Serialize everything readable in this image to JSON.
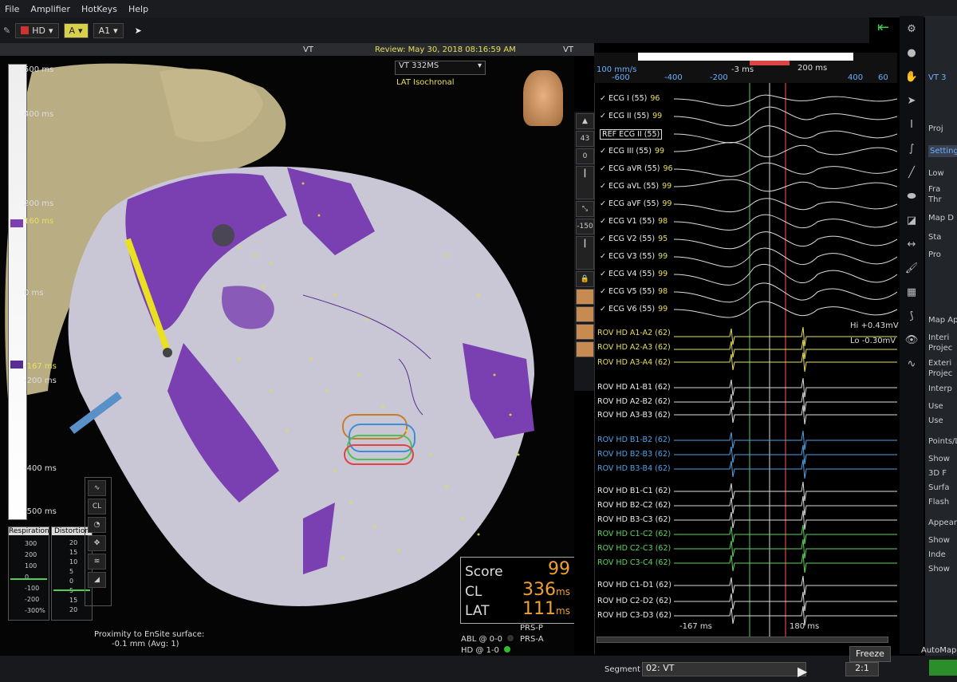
{
  "menu": [
    "File",
    "Amplifier",
    "HotKeys",
    "Help"
  ],
  "toolbar": {
    "catheter": "HD",
    "channel_a": "A",
    "channel_a1": "A1"
  },
  "titlebar": {
    "view_label": "VT",
    "review": "Review: May 30, 2018 08:16:59 AM",
    "view_label_right": "VT"
  },
  "map": {
    "name": "VT 332MS",
    "subtitle": "LAT Isochronal"
  },
  "scale_labels": {
    "top": "500 ms",
    "l400": "400 ms",
    "l200": "200 ms",
    "l160": "160 ms",
    "l0": "0 ms",
    "lm167": "-167 ms",
    "lm200": "-200 ms",
    "lm400": "-400 ms",
    "lm500": "-500 ms"
  },
  "vtool_values": {
    "v43": "43",
    "v0": "0",
    "vm150": "-150"
  },
  "timeline": {
    "sweep": "100 mm/s",
    "ticks": [
      "-600",
      "-400",
      "-200",
      "-3 ms",
      "200 ms",
      "400",
      "60"
    ]
  },
  "ecg": [
    {
      "label": "ECG I (55)",
      "num": "96"
    },
    {
      "label": "ECG II (55)",
      "num": "99"
    },
    {
      "label": "REF ECG II (55)",
      "num": ""
    },
    {
      "label": "ECG III (55)",
      "num": "99"
    },
    {
      "label": "ECG aVR (55)",
      "num": "96"
    },
    {
      "label": "ECG aVL (55)",
      "num": "99"
    },
    {
      "label": "ECG aVF (55)",
      "num": "99"
    },
    {
      "label": "ECG V1 (55)",
      "num": "98"
    },
    {
      "label": "ECG V2 (55)",
      "num": "95"
    },
    {
      "label": "ECG V3 (55)",
      "num": "99"
    },
    {
      "label": "ECG V4 (55)",
      "num": "99"
    },
    {
      "label": "ECG V5 (55)",
      "num": "98"
    },
    {
      "label": "ECG V6 (55)",
      "num": "99"
    }
  ],
  "range_labels": {
    "hi": "Hi +0.43mV",
    "lo": "Lo -0.30mV"
  },
  "channels": [
    {
      "label": "ROV HD  A1-A2 (62)",
      "color": "#e8e05a"
    },
    {
      "label": "ROV HD  A2-A3 (62)",
      "color": "#e8e05a"
    },
    {
      "label": "ROV HD  A3-A4 (62)",
      "color": "#e8e05a"
    },
    {
      "label": "ROV HD  A1-B1 (62)",
      "color": "#eeeeee"
    },
    {
      "label": "ROV HD  A2-B2 (62)",
      "color": "#eeeeee"
    },
    {
      "label": "ROV HD  A3-B3 (62)",
      "color": "#eeeeee"
    },
    {
      "label": "ROV HD  B1-B2 (62)",
      "color": "#4fa3e8"
    },
    {
      "label": "ROV HD  B2-B3 (62)",
      "color": "#4fa3e8"
    },
    {
      "label": "ROV HD  B3-B4 (62)",
      "color": "#4fa3e8"
    },
    {
      "label": "ROV HD  B1-C1 (62)",
      "color": "#eeeeee"
    },
    {
      "label": "ROV HD  B2-C2 (62)",
      "color": "#eeeeee"
    },
    {
      "label": "ROV HD  B3-C3 (62)",
      "color": "#eeeeee"
    },
    {
      "label": "ROV HD  C1-C2 (62)",
      "color": "#5ed65e"
    },
    {
      "label": "ROV HD  C2-C3 (62)",
      "color": "#5ed65e"
    },
    {
      "label": "ROV HD  C3-C4 (62)",
      "color": "#5ed65e"
    },
    {
      "label": "ROV HD  C1-D1 (62)",
      "color": "#eeeeee"
    },
    {
      "label": "ROV HD  C2-D2 (62)",
      "color": "#eeeeee"
    },
    {
      "label": "ROV HD  C3-D3 (62)",
      "color": "#eeeeee"
    }
  ],
  "trace_bottom": {
    "left": "-167 ms",
    "right": "180 ms"
  },
  "score": {
    "score_label": "Score",
    "score_value": "99",
    "cl_label": "CL",
    "cl_value": "336",
    "cl_unit": "ms",
    "lat_label": "LAT",
    "lat_value": "111",
    "lat_unit": "ms"
  },
  "respiration": {
    "title": "Respiration",
    "ticks": [
      "300",
      "200",
      "100",
      "0",
      "-100",
      "-200",
      "-300%"
    ]
  },
  "distortion": {
    "title": "Distortion",
    "ticks": [
      "20",
      "15",
      "10",
      "5",
      "0",
      "5",
      "15",
      "20"
    ]
  },
  "proximity": {
    "line1": "Proximity to EnSite surface:",
    "line2": "-0.1 mm (Avg: 1)"
  },
  "status": {
    "abl": "ABL @ 0-0",
    "hd": "HD @ 1-0",
    "prsp": "PRS-P",
    "prsa": "PRS-A"
  },
  "bottom": {
    "segment_label": "Segment",
    "segment_value": "02: VT",
    "speed": "2:1",
    "freeze": "Freeze",
    "automap": "AutoMap"
  },
  "right_panel": [
    "VT 3",
    "Proj",
    "Setting",
    "Low",
    "Fra",
    "Thr",
    "Map D",
    "Sta",
    "Pro",
    "Map Ap",
    "Interi",
    "Projec",
    "Exteri",
    "Projec",
    "Interp",
    "Use",
    "Use",
    "Points/L",
    "Show",
    "3D F",
    "Surfa",
    "Flash",
    "Appear",
    "Show",
    "Inde",
    "Show"
  ],
  "colors": {
    "accent": "#e8e05a",
    "orange": "#f0a030",
    "purple": "#7a3fb0"
  }
}
